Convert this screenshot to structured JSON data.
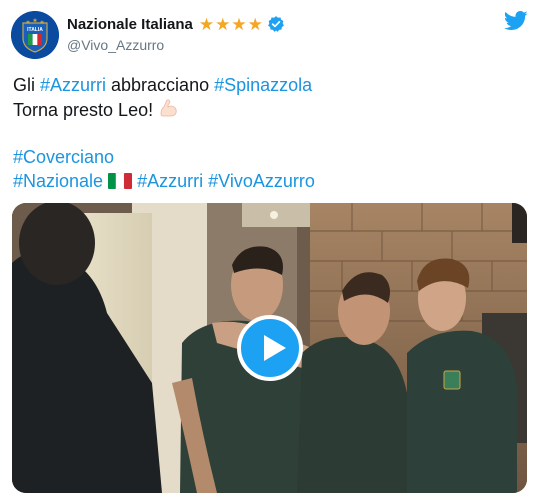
{
  "account": {
    "display_name": "Nazionale Italiana",
    "handle": "@Vivo_Azzurro",
    "avatar_text": "ITALIA",
    "star_count": 4,
    "verified": true,
    "colors": {
      "stars": "#f5a623",
      "verified": "#1da1f2",
      "avatar": "#0a4ba0"
    }
  },
  "platform": {
    "logo_icon": "twitter-bird-icon",
    "color": "#1da1f2"
  },
  "tweet": {
    "line1_prefix": "Gli ",
    "line1_tag1": "#Azzurri",
    "line1_mid": " abbracciano ",
    "line1_tag2": "#Spinazzola",
    "line2_text": "Torna presto Leo! ",
    "line2_emoji": "flexed-biceps-icon",
    "line3_tag": "#Coverciano",
    "line4_tag1": "#Nazionale",
    "line4_emoji": "italy-flag-icon",
    "line4_tag2": "#Azzurri",
    "line4_tag3": "#VivoAzzurro",
    "hashtag_color": "#1b95e0"
  },
  "media": {
    "type": "video",
    "play_icon": "play-icon"
  }
}
